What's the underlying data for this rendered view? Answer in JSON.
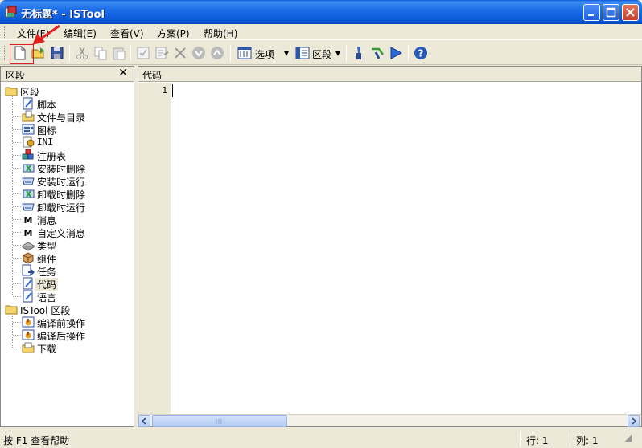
{
  "window": {
    "title": "无标题* - ISTool",
    "minimize": "minimize",
    "maximize": "maximize",
    "close": "close"
  },
  "menu": {
    "items": [
      "文件(F)",
      "编辑(E)",
      "查看(V)",
      "方案(P)",
      "帮助(H)"
    ]
  },
  "toolbar": {
    "options_label": "选项",
    "sections_label": "区段"
  },
  "left_panel": {
    "title": "区段",
    "close": "✕",
    "tree": {
      "root1": "区段",
      "items": [
        "脚本",
        "文件与目录",
        "图标",
        "INI",
        "注册表",
        "安装时删除",
        "安装时运行",
        "卸载时删除",
        "卸载时运行",
        "消息",
        "自定义消息",
        "类型",
        "组件",
        "任务",
        "代码",
        "语言"
      ],
      "root2": "ISTool 区段",
      "items2": [
        "编译前操作",
        "编译后操作",
        "下载"
      ]
    }
  },
  "editor": {
    "title": "代码",
    "line_number": "1"
  },
  "status": {
    "help": "按 F1 查看帮助",
    "row": "行: 1",
    "col": "列: 1"
  }
}
